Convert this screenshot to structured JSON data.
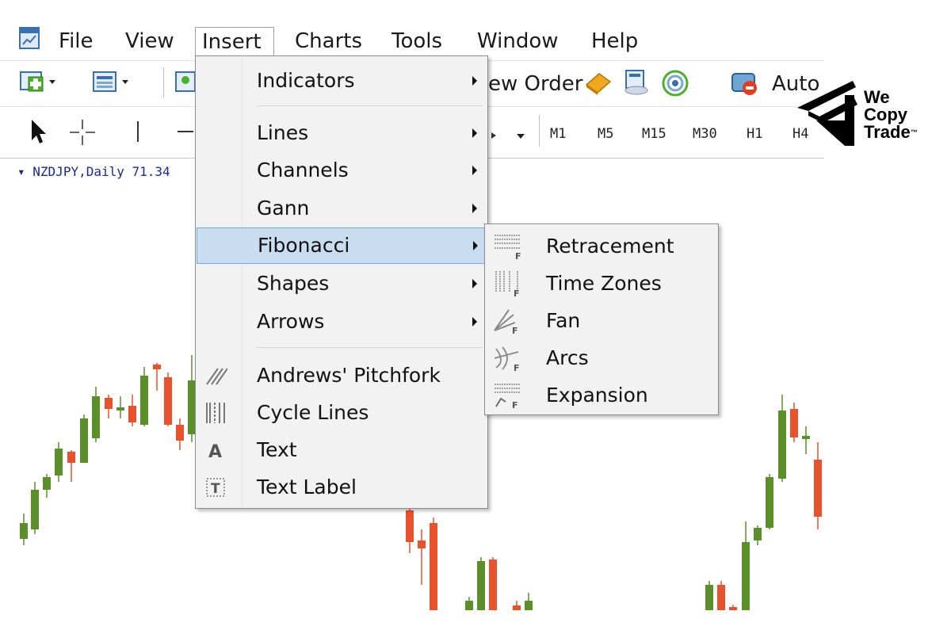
{
  "menubar": {
    "items": [
      "File",
      "View",
      "Insert",
      "Charts",
      "Tools",
      "Window",
      "Help"
    ],
    "open_item": "Insert"
  },
  "toolbar": {
    "new_order_text": "ew Order",
    "auto_text": "Auto",
    "timeframes": [
      "M1",
      "M5",
      "M15",
      "M30",
      "H1",
      "H4"
    ]
  },
  "chart": {
    "symbol_label": "NZDJPY,Daily  71.34",
    "bull_color": "#5a8f2a",
    "bear_color": "#e8522c"
  },
  "insert_menu": {
    "items": [
      {
        "label": "Indicators",
        "submenu": true,
        "icon": ""
      },
      {
        "label": "Lines",
        "submenu": true,
        "icon": ""
      },
      {
        "label": "Channels",
        "submenu": true,
        "icon": ""
      },
      {
        "label": "Gann",
        "submenu": true,
        "icon": ""
      },
      {
        "label": "Fibonacci",
        "submenu": true,
        "icon": "",
        "highlighted": true
      },
      {
        "label": "Shapes",
        "submenu": true,
        "icon": ""
      },
      {
        "label": "Arrows",
        "submenu": true,
        "icon": ""
      },
      {
        "label": "Andrews' Pitchfork",
        "submenu": false,
        "icon": "pitchfork-icon"
      },
      {
        "label": "Cycle Lines",
        "submenu": false,
        "icon": "cycle-lines-icon"
      },
      {
        "label": "Text",
        "submenu": false,
        "icon": "text-icon"
      },
      {
        "label": "Text Label",
        "submenu": false,
        "icon": "text-label-icon"
      }
    ],
    "highlight_color": "#c9ddf0"
  },
  "fibonacci_submenu": {
    "items": [
      {
        "label": "Retracement",
        "icon": "fibo-retracement-icon"
      },
      {
        "label": "Time Zones",
        "icon": "fibo-time-zones-icon"
      },
      {
        "label": "Fan",
        "icon": "fibo-fan-icon"
      },
      {
        "label": "Arcs",
        "icon": "fibo-arcs-icon"
      },
      {
        "label": "Expansion",
        "icon": "fibo-expansion-icon"
      }
    ]
  },
  "logo": {
    "line1": "We",
    "line2": "Copy",
    "line3": "Trade",
    "tm": "™"
  }
}
